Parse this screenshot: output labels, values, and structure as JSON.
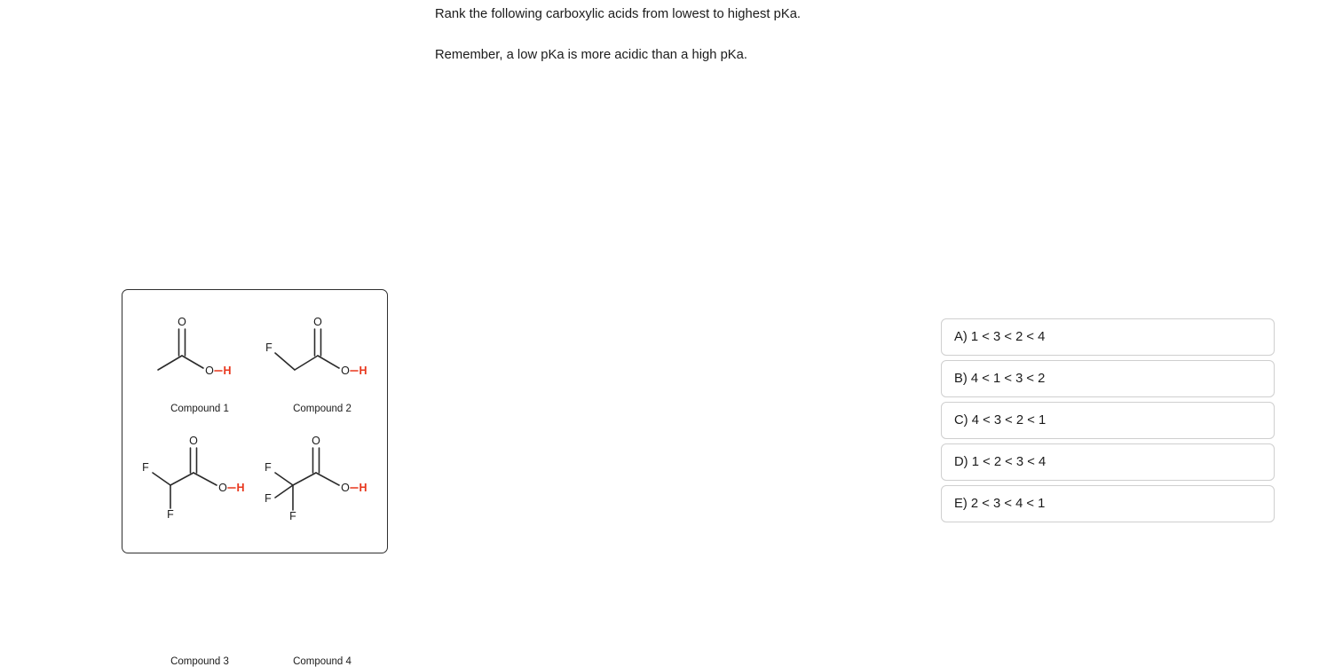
{
  "question": {
    "line1": "Rank the following carboxylic acids from lowest to highest pKa.",
    "line2": "Remember, a low pKa is more acidic than a high pKa."
  },
  "structures": {
    "panel_border_color": "#2f2f2f",
    "compounds": [
      {
        "id": 1,
        "label": "Compound 1",
        "name": "acetic acid",
        "substituents": [],
        "atoms": {
          "carbonyl_oxygen": "O",
          "hydroxyl_oxygen": "O",
          "acidic_hydrogen": "H"
        }
      },
      {
        "id": 2,
        "label": "Compound 2",
        "name": "fluoroacetic acid",
        "substituents": [
          "F"
        ],
        "atoms": {
          "carbonyl_oxygen": "O",
          "hydroxyl_oxygen": "O",
          "acidic_hydrogen": "H"
        }
      },
      {
        "id": 3,
        "label": "Compound 3",
        "name": "difluoroacetic acid",
        "substituents": [
          "F",
          "F"
        ],
        "atoms": {
          "carbonyl_oxygen": "O",
          "hydroxyl_oxygen": "O",
          "acidic_hydrogen": "H"
        }
      },
      {
        "id": 4,
        "label": "Compound 4",
        "name": "trifluoroacetic acid",
        "substituents": [
          "F",
          "F",
          "F"
        ],
        "atoms": {
          "carbonyl_oxygen": "O",
          "hydroxyl_oxygen": "O",
          "acidic_hydrogen": "H"
        }
      }
    ],
    "colors": {
      "bond": "#2b2b2b",
      "atom_label": "#1b1b1b",
      "acidic_hydrogen": "#e8361c"
    }
  },
  "answers": {
    "options": [
      {
        "key": "A",
        "text": "A) 1 < 3 < 2 < 4"
      },
      {
        "key": "B",
        "text": "B) 4 < 1 < 3 < 2"
      },
      {
        "key": "C",
        "text": "C) 4 < 3 < 2 < 1"
      },
      {
        "key": "D",
        "text": "D) 1 < 2 < 3 < 4"
      },
      {
        "key": "E",
        "text": "E) 2 < 3 < 4 < 1"
      }
    ]
  }
}
